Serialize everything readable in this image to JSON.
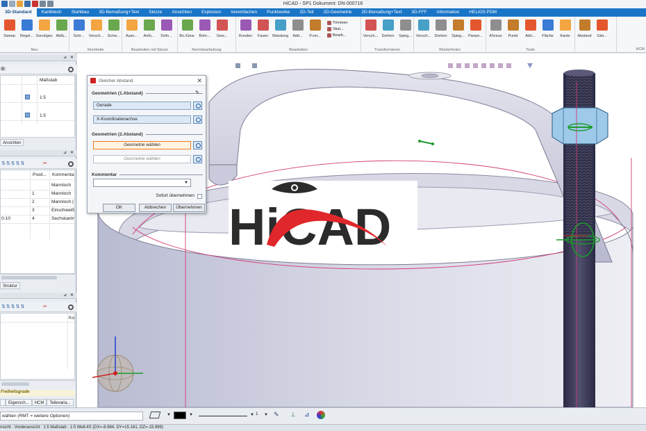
{
  "window": {
    "title": "HiCAD - SP1   Dokument: DN-000718"
  },
  "ribbon": {
    "tabs": [
      "3D-Standard",
      "Kantblech",
      "Stahlbau",
      "3D-Bemaßung+Text",
      "Skizze",
      "Ansichten",
      "Explosion",
      "Vereinfachen",
      "Punktwolke",
      "2D-Teil",
      "2D-Geometrie",
      "2D-Bemaßung+Text",
      "3D-FFF",
      "Information",
      "HELiOS PDM"
    ],
    "active_tab": "3D-Standard",
    "groups": [
      {
        "name": "Neu",
        "buttons": [
          "Sweep",
          "Regel...",
          "Sonstiges",
          "Abfä..."
        ]
      },
      {
        "name": "Normteile",
        "buttons": [
          "Schr...",
          "Versch...",
          "Schw..."
        ]
      },
      {
        "name": "Bearbeiten mit Skizze",
        "buttons": [
          "Ausn...",
          "Anfü...",
          "Defo..."
        ]
      },
      {
        "name": "Normbearbeitung",
        "buttons": [
          "Bo./Gew.",
          "Bohr...",
          "Gew..."
        ]
      },
      {
        "name": "Bearbeiten",
        "buttons": [
          "Runden",
          "Fasen",
          "Wandung",
          "Add...",
          "P.ver..."
        ],
        "side": [
          "Trimmen",
          "Skal...",
          "Bearb..."
        ]
      },
      {
        "name": "Transformieren",
        "buttons": [
          "Versch...",
          "Drehen",
          "Spieg..."
        ]
      },
      {
        "name": "Wiederholen",
        "buttons": [
          "Versch...",
          "Drehen",
          "Spieg...",
          "Param..."
        ]
      },
      {
        "name": "Tools",
        "buttons": [
          "A'kreuz",
          "Punkt",
          "Attri...",
          "Fläche",
          "Kante"
        ]
      },
      {
        "name": "",
        "buttons": [
          "Abstand",
          "Glei..."
        ]
      }
    ],
    "last_group_label": "HCM"
  },
  "left_panel": {
    "views": {
      "header": "Maßstab",
      "rows": [
        {
          "scale": "1:5"
        },
        {
          "scale": "1:5"
        }
      ],
      "tab": "Ansichten"
    },
    "structure": {
      "headers": [
        "Posit...",
        "Kommenta"
      ],
      "rows": [
        {
          "name": "",
          "pos": "",
          "comment": "Mannloch"
        },
        {
          "name": "",
          "pos": "1",
          "comment": "Mannloch"
        },
        {
          "name": "",
          "pos": "2",
          "comment": "Mannloch ("
        },
        {
          "name": "",
          "pos": "3",
          "comment": "Einschweiß"
        },
        {
          "name": "0-10",
          "pos": "4",
          "comment": "Sechskantn"
        }
      ],
      "tab": "Struktur"
    },
    "hcm": {
      "header": "Ko",
      "footer": "Freiheitsgrade"
    },
    "bottom_tabs": [
      "Eigensch...",
      "HCM",
      "Teilevaria..."
    ]
  },
  "dialog": {
    "title": "Gleicher Abstand",
    "section1": "Geometrien (1.Abstand)",
    "field1": "Gerade",
    "field2": "X-Koordinatenachse",
    "section2": "Geometrien (2.Abstand)",
    "field3": "Geometrie wählen",
    "field4": "Geometrie wählen",
    "section3": "Kommentar",
    "comment_value": "",
    "apply_immediately": "Sofort übernehmen",
    "ok": "OK",
    "cancel": "Abbrechen",
    "apply": "Übernehmen"
  },
  "logo": {
    "text": "HiCAD",
    "colors": {
      "dark": "#2b2b2b",
      "accent": "#e0272b"
    }
  },
  "command_line": {
    "prompt": "wählen (RMT = weitere Optionen)",
    "line_width": "1"
  },
  "status_bar": {
    "text": "nsicht : Vorderansicht : 1:5     Maßstab : 1:5    Welt:4S  (DX=-8.984, DY=15.181, DZ=-15.999)"
  },
  "colors": {
    "tab_bar": "#1a75c7",
    "viewport_bg": "#ffffff",
    "model_gray": "#c8c8d8",
    "bolt": "#3a3a5a",
    "nut": "#8fbfe0",
    "highlight_field": "#f07c1e"
  }
}
